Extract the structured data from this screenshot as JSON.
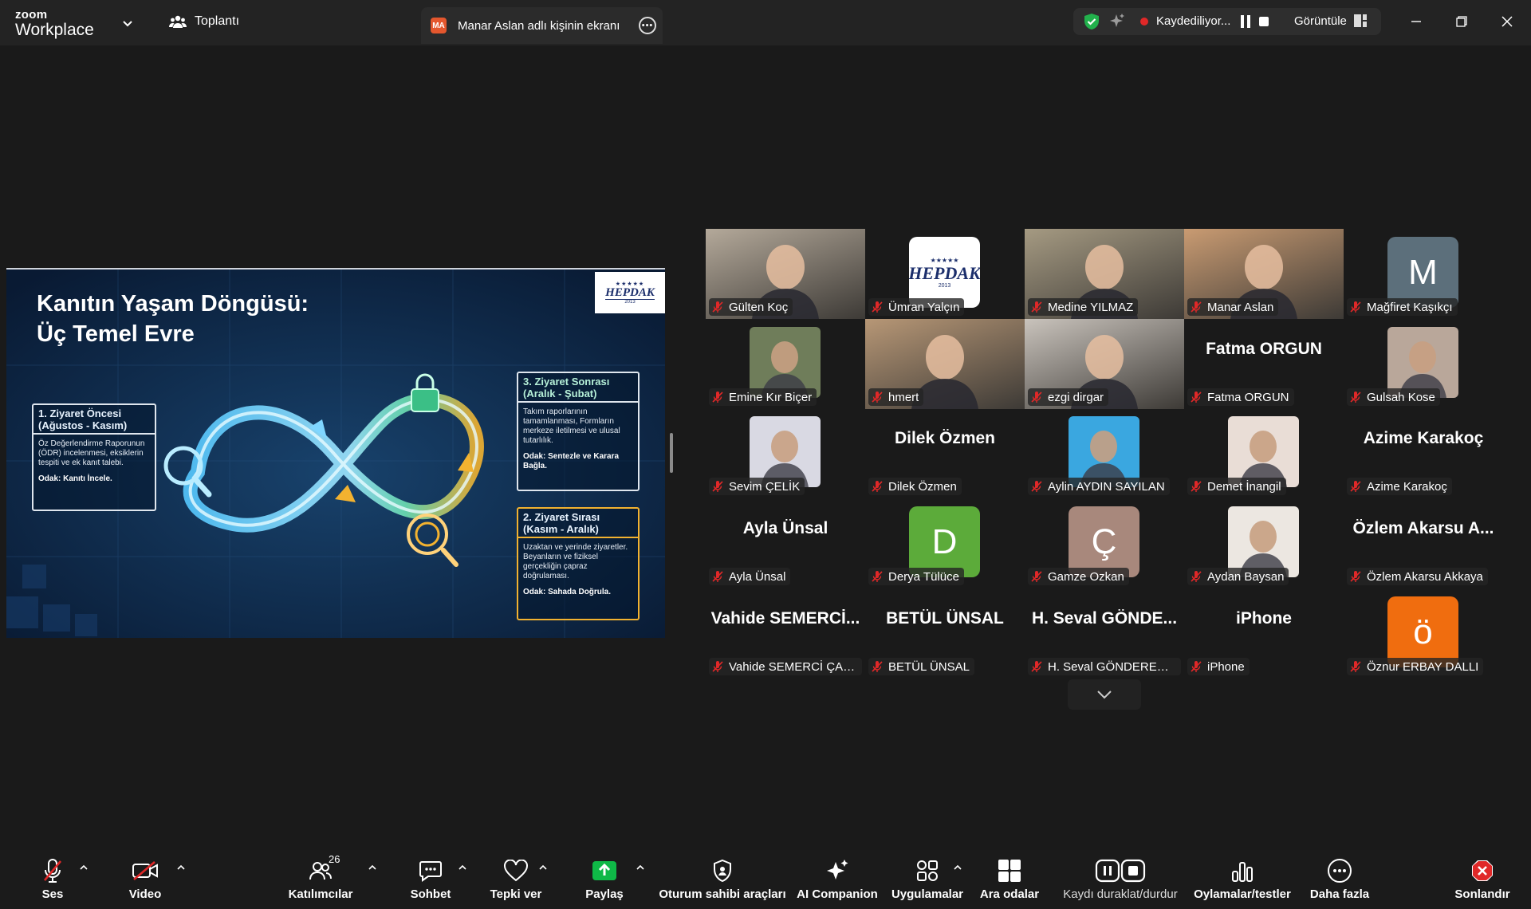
{
  "titlebar": {
    "brand_small": "zoom",
    "brand_big": "Workplace",
    "meeting_label": "Toplantı",
    "share_tab_initials": "MA",
    "share_tab_label": "Manar Aslan adlı kişinin ekranı",
    "recording_label": "Kaydediliyor...",
    "view_label": "Görüntüle"
  },
  "slide": {
    "title_line1": "Kanıtın Yaşam Döngüsü:",
    "title_line2": "Üç Temel Evre",
    "logo_stars": "★★★★★",
    "logo_text": "HEPDAK",
    "logo_year": "2013",
    "boxes": [
      {
        "heading": "1. Ziyaret Öncesi (Ağustos - Kasım)",
        "body": "Öz Değerlendirme Raporunun (ÖDR) incelenmesi, eksiklerin tespiti ve ek kanıt talebi.",
        "focus": "Odak: Kanıtı İncele."
      },
      {
        "heading": "3. Ziyaret Sonrası (Aralık - Şubat)",
        "body": "Takım raporlarının tamamlanması, Formların merkeze iletilmesi ve ulusal tutarlılık.",
        "focus": "Odak: Sentezle ve Karara Bağla."
      },
      {
        "heading": "2. Ziyaret Sırası (Kasım - Aralık)",
        "body": "Uzaktan ve yerinde ziyaretler. Beyanların ve fiziksel gerçekliğin çapraz doğrulaması.",
        "focus": "Odak: Sahada Doğrula."
      }
    ]
  },
  "participants": [
    {
      "name": "Gülten Koç",
      "type": "video",
      "color": "#b4a99a"
    },
    {
      "name": "Ümran Yalçın",
      "type": "logo",
      "color": "#ffffff"
    },
    {
      "name": "Medine YILMAZ",
      "type": "video",
      "color": "#a59a82"
    },
    {
      "name": "Manar Aslan",
      "type": "video",
      "color": "#c99b72",
      "active": true
    },
    {
      "name": "Mağfiret Kaşıkçı",
      "type": "initial",
      "initial": "M",
      "color": "#5c6f7b"
    },
    {
      "name": "Emine Kır Biçer",
      "type": "avatar",
      "color": "#6f7d5a"
    },
    {
      "name": "hmert",
      "type": "video",
      "color": "#b79776"
    },
    {
      "name": "ezgi dirgar",
      "type": "video",
      "color": "#c9c3bc"
    },
    {
      "name": "Fatma ORGUN",
      "type": "text",
      "big": "Fatma ORGUN"
    },
    {
      "name": "Gulsah Kose",
      "type": "avatar",
      "color": "#b9a79a"
    },
    {
      "name": "Sevim ÇELİK",
      "type": "avatar",
      "color": "#d9d9e3"
    },
    {
      "name": "Dilek Özmen",
      "type": "text",
      "big": "Dilek Özmen"
    },
    {
      "name": "Aylin AYDIN SAYILAN",
      "type": "avatar",
      "color": "#3aa7e0"
    },
    {
      "name": "Demet İnangil",
      "type": "avatar",
      "color": "#e9ddd6"
    },
    {
      "name": "Azime Karakoç",
      "type": "text",
      "big": "Azime Karakoç"
    },
    {
      "name": "Ayla Ünsal",
      "type": "text",
      "big": "Ayla Ünsal"
    },
    {
      "name": "Derya Tülüce",
      "type": "initial",
      "initial": "D",
      "color": "#5cab3a"
    },
    {
      "name": "Gamze Ozkan",
      "type": "initial",
      "initial": "Ç",
      "color": "#a8887c"
    },
    {
      "name": "Aydan Baysan",
      "type": "avatar",
      "color": "#ece7e1"
    },
    {
      "name": "Özlem Akarsu Akkaya",
      "type": "text",
      "big": "Özlem Akarsu A..."
    },
    {
      "name": "Vahide SEMERCİ ÇAK...",
      "type": "text",
      "big": "Vahide SEMERCİ..."
    },
    {
      "name": "BETÜL ÜNSAL",
      "type": "text",
      "big": "BETÜL ÜNSAL"
    },
    {
      "name": "H. Seval GÖNDEREN Ç...",
      "type": "text",
      "big": "H. Seval GÖNDE..."
    },
    {
      "name": "iPhone",
      "type": "text",
      "big": "iPhone"
    },
    {
      "name": "Öznur ERBAY DALLI",
      "type": "initial",
      "initial": "ö",
      "color": "#f06d0f"
    }
  ],
  "toolbar": {
    "audio": "Ses",
    "video": "Video",
    "participants": "Katılımcılar",
    "participant_count": "26",
    "chat": "Sohbet",
    "react": "Tepki ver",
    "share": "Paylaş",
    "host_tools": "Oturum sahibi araçları",
    "ai": "AI Companion",
    "apps": "Uygulamalar",
    "breakout": "Ara odalar",
    "pause_rec": "Kaydı duraklat/durdur",
    "polls": "Oylamalar/testler",
    "more": "Daha fazla",
    "end": "Sonlandır"
  },
  "colors": {
    "accent_green": "#4ad07b",
    "end_red": "#e02828",
    "share_green": "#0fb847"
  }
}
